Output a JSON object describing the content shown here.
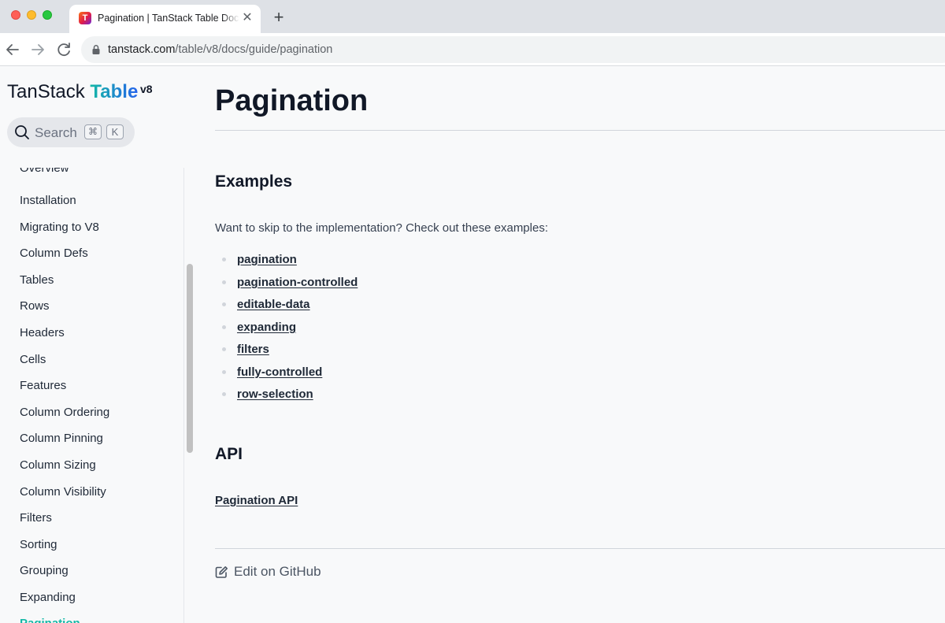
{
  "browser": {
    "tab_title": "Pagination | TanStack Table Docs",
    "tab_favicon_letter": "T",
    "tab_close": "✕",
    "new_tab": "+",
    "url_host": "tanstack.com",
    "url_path": "/table/v8/docs/guide/pagination"
  },
  "brand": {
    "name": "TanStack",
    "product": "Table",
    "version": "v8"
  },
  "search": {
    "label": "Search",
    "shortcut_modifier": "⌘",
    "shortcut_key": "K"
  },
  "sidebar": {
    "items": [
      {
        "label": "Overview"
      },
      {
        "label": "Installation"
      },
      {
        "label": "Migrating to V8"
      },
      {
        "label": "Column Defs"
      },
      {
        "label": "Tables"
      },
      {
        "label": "Rows"
      },
      {
        "label": "Headers"
      },
      {
        "label": "Cells"
      },
      {
        "label": "Features"
      },
      {
        "label": "Column Ordering"
      },
      {
        "label": "Column Pinning"
      },
      {
        "label": "Column Sizing"
      },
      {
        "label": "Column Visibility"
      },
      {
        "label": "Filters"
      },
      {
        "label": "Sorting"
      },
      {
        "label": "Grouping"
      },
      {
        "label": "Expanding"
      },
      {
        "label": "Pagination",
        "active": true
      }
    ]
  },
  "main": {
    "title": "Pagination",
    "examples_heading": "Examples",
    "examples_intro": "Want to skip to the implementation? Check out these examples:",
    "examples": [
      "pagination",
      "pagination-controlled",
      "editable-data",
      "expanding",
      "filters",
      "fully-controlled",
      "row-selection"
    ],
    "api_heading": "API",
    "api_link": "Pagination API",
    "edit_label": "Edit on GitHub"
  },
  "colors": {
    "brand_gradient_start": "#14b8a6",
    "brand_gradient_end": "#2563eb",
    "active_nav": "#14b8a6"
  }
}
